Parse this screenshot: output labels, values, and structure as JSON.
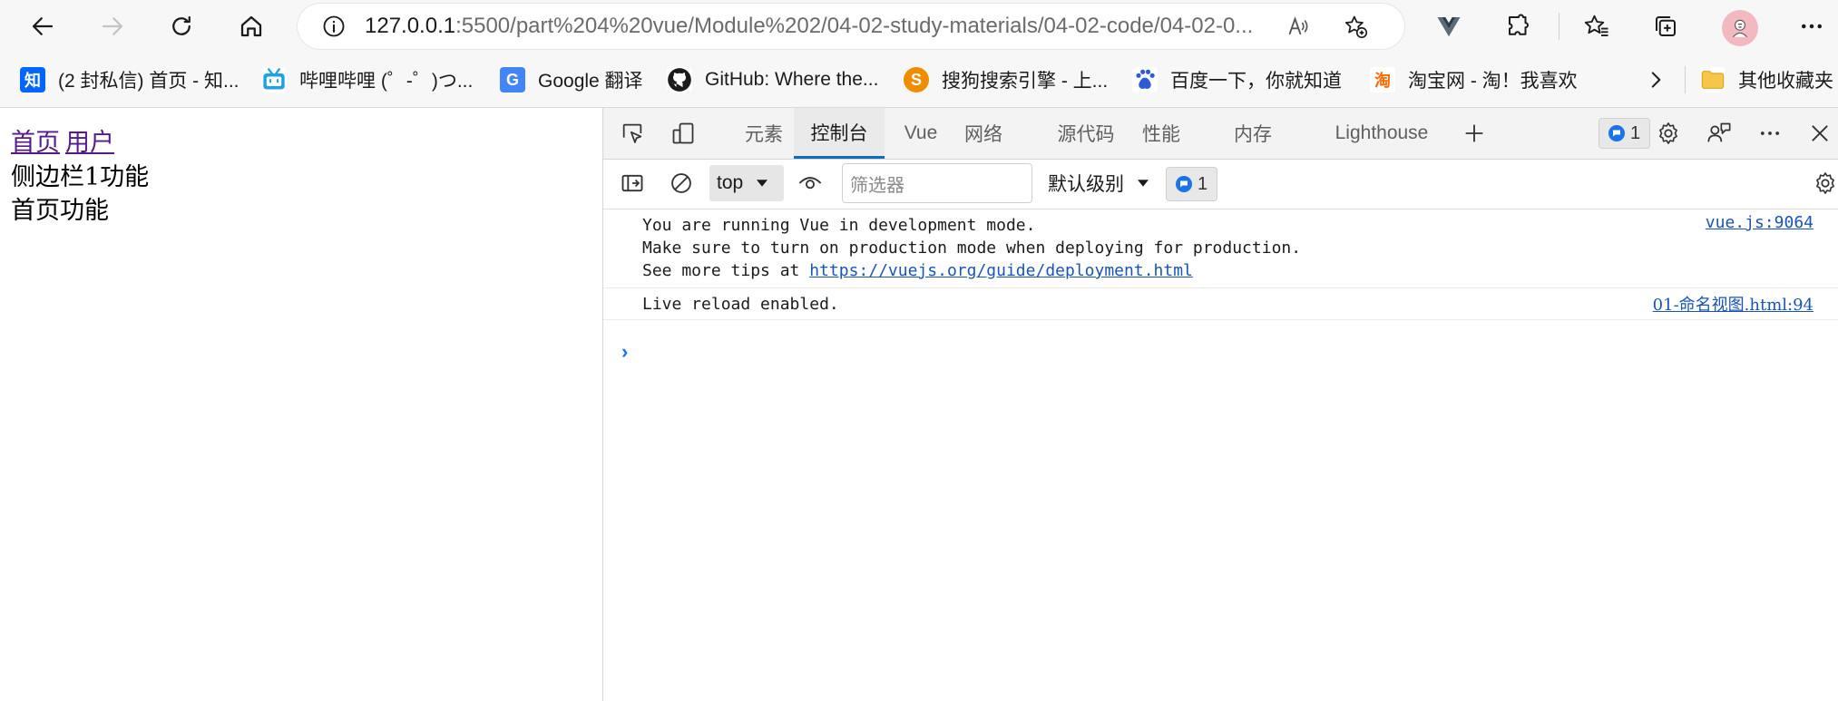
{
  "toolbar": {
    "icons": [
      "back-arrow-icon",
      "forward-arrow-icon",
      "refresh-icon",
      "home-icon",
      "site-info-icon",
      "read-aloud-icon",
      "add-favorite-icon",
      "vue-devtools-icon",
      "extensions-icon",
      "favorites-icon",
      "collections-icon",
      "profile-avatar",
      "more-icon"
    ],
    "url_host": "127.0.0.1",
    "url_rest": ":5500/part%204%20vue/Module%202/04-02-study-materials/04-02-code/04-02-0...",
    "read_aloud_label": "A̅"
  },
  "bookmarks": [
    {
      "label": "(2 封私信) 首页 - 知...",
      "icon": "zhihu-icon",
      "icon_text": "知",
      "color": "#0066ff"
    },
    {
      "label": "哔哩哔哩 (゜-゜)つ...",
      "icon": "bilibili-icon",
      "icon_text": "",
      "color": "#20a0e8"
    },
    {
      "label": "Google 翻译",
      "icon": "google-translate-icon",
      "icon_text": "G",
      "color": "#4285f4"
    },
    {
      "label": "GitHub: Where the...",
      "icon": "github-icon",
      "icon_text": "",
      "color": "#1b1b1b"
    },
    {
      "label": "搜狗搜索引擎 - 上...",
      "icon": "sogou-icon",
      "icon_text": "S",
      "color": "#f08c00"
    },
    {
      "label": "百度一下，你就知道",
      "icon": "baidu-icon",
      "icon_text": "du",
      "color": "#2d5bd8"
    },
    {
      "label": "淘宝网 - 淘！我喜欢",
      "icon": "taobao-icon",
      "icon_text": "淘",
      "color": "#ff6a00"
    },
    {
      "label": "其他收藏夹",
      "icon": "folder-icon",
      "icon_text": "",
      "color": "#e8b83a"
    }
  ],
  "page": {
    "links": [
      "首页",
      "用户"
    ],
    "sidebar_text": "侧边栏1功能",
    "home_text": "首页功能"
  },
  "devtools": {
    "tabs": [
      "元素",
      "控制台",
      "Vue",
      "网络",
      "源代码",
      "性能",
      "内存",
      "Lighthouse"
    ],
    "active_tab": "控制台",
    "issues_count": "1",
    "context": "top",
    "filter_placeholder": "筛选器",
    "level": "默认级别",
    "message_count": "1",
    "messages": [
      {
        "lines": [
          "You are running Vue in development mode.",
          "Make sure to turn on production mode when deploying for production.",
          "See more tips at "
        ],
        "link": "https://vuejs.org/guide/deployment.html",
        "source": "vue.js:9064"
      },
      {
        "lines": [
          "Live reload enabled."
        ],
        "source": "01-命名视图.html:94"
      }
    ],
    "prompt": "›",
    "accent_color": "#0f6cbd"
  }
}
